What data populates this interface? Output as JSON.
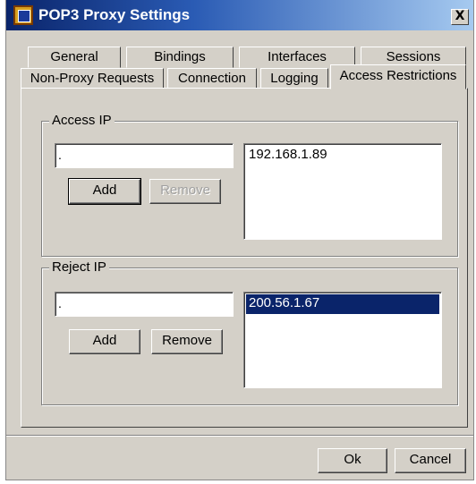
{
  "window": {
    "title": "POP3 Proxy Settings",
    "close_label": "X"
  },
  "tabs": {
    "row_top": [
      "General",
      "Bindings",
      "Interfaces",
      "Sessions"
    ],
    "row_bottom": [
      "Non-Proxy Requests",
      "Connection",
      "Logging",
      "Access Restrictions"
    ],
    "active": "Access Restrictions"
  },
  "access_ip": {
    "group_label": "Access IP",
    "input_value": ".",
    "add_label": "Add",
    "remove_label": "Remove",
    "remove_enabled": false,
    "list": [
      "192.168.1.89"
    ]
  },
  "reject_ip": {
    "group_label": "Reject IP",
    "input_value": ".",
    "add_label": "Add",
    "remove_label": "Remove",
    "remove_enabled": true,
    "list": [
      "200.56.1.67"
    ],
    "selected_index": 0
  },
  "footer": {
    "ok_label": "Ok",
    "cancel_label": "Cancel"
  },
  "colors": {
    "title_bar": "#0a246a",
    "selection": "#0a246a",
    "face": "#d4d0c8"
  }
}
